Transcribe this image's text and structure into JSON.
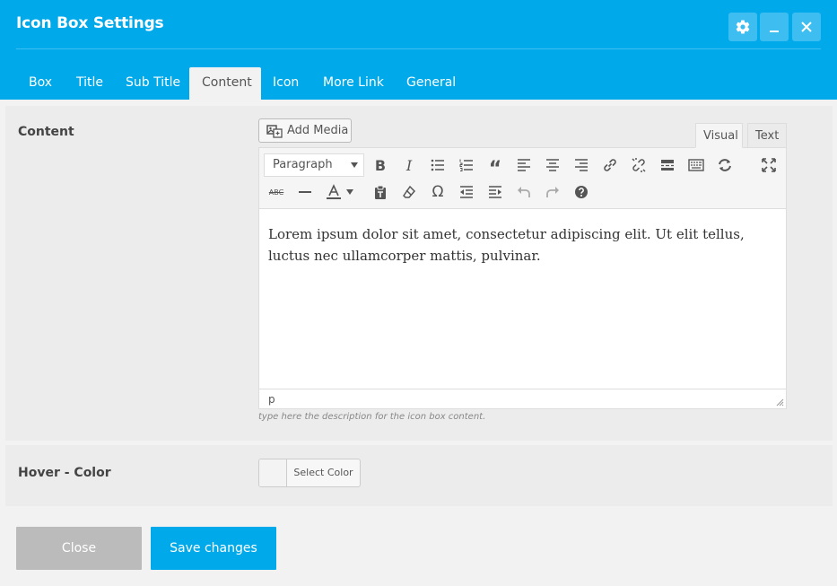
{
  "dialog": {
    "title": "Icon Box Settings"
  },
  "tabs": [
    {
      "label": "Box"
    },
    {
      "label": "Title"
    },
    {
      "label": "Sub Title"
    },
    {
      "label": "Content"
    },
    {
      "label": "Icon"
    },
    {
      "label": "More Link"
    },
    {
      "label": "General"
    }
  ],
  "active_tab": "Content",
  "content_field": {
    "label": "Content",
    "add_media": "Add Media",
    "mode_tabs": {
      "visual": "Visual",
      "text": "Text"
    },
    "format_select": "Paragraph",
    "body": "Lorem ipsum dolor sit amet, consectetur adipiscing elit. Ut elit tellus, luctus nec ullamcorper mattis, pulvinar.",
    "status_path": "p",
    "help": "type here the description for the icon box content."
  },
  "hover_color": {
    "label": "Hover - Color",
    "button": "Select Color"
  },
  "footer": {
    "close": "Close",
    "save": "Save changes"
  },
  "icons": [
    "gear-icon",
    "minimize-icon",
    "close-icon",
    "add-media-icon",
    "bold-icon",
    "italic-icon",
    "bullet-list-icon",
    "numbered-list-icon",
    "blockquote-icon",
    "align-left-icon",
    "align-center-icon",
    "align-right-icon",
    "link-icon",
    "unlink-icon",
    "read-more-icon",
    "toolbar-toggle-icon",
    "refresh-icon",
    "fullscreen-icon",
    "strikethrough-icon",
    "horizontal-line-icon",
    "text-color-icon",
    "paste-text-icon",
    "clear-formatting-icon",
    "special-character-icon",
    "outdent-icon",
    "indent-icon",
    "undo-icon",
    "redo-icon",
    "help-icon"
  ],
  "colors": {
    "brand": "#00a9ea",
    "panel": "#ececec",
    "close_btn": "#bbbbbb"
  }
}
